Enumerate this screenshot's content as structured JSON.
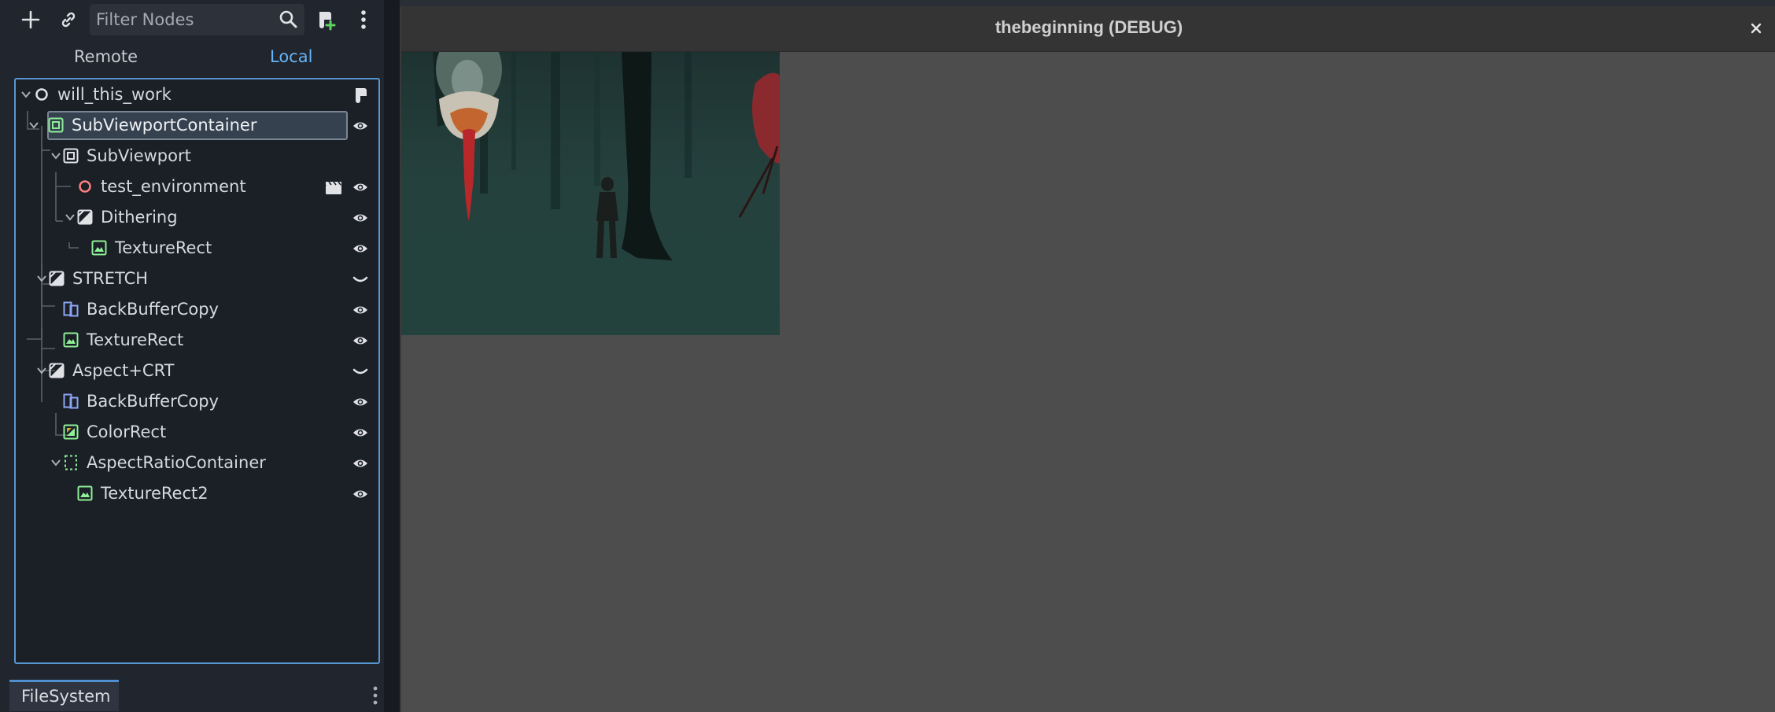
{
  "toolbar": {
    "add_node_icon": "plus-icon",
    "link_icon": "link-icon",
    "filter_placeholder": "Filter Nodes",
    "search_icon": "search-icon",
    "add_script_icon": "add-script-icon",
    "menu_icon": "kebab-menu-icon"
  },
  "mode_tabs": {
    "remote": "Remote",
    "local": "Local",
    "active": "local"
  },
  "tree": {
    "nodes": [
      {
        "label": "will_this_work",
        "type": "Node",
        "depth": 0,
        "expanded": true,
        "extra_icon": "script-icon"
      },
      {
        "label": "SubViewportContainer",
        "type": "SubViewportContainer",
        "depth": 1,
        "expanded": true,
        "selected": true,
        "visible": true
      },
      {
        "label": "SubViewport",
        "type": "SubViewport",
        "depth": 2,
        "expanded": true
      },
      {
        "label": "test_environment",
        "type": "Node3D",
        "depth": 3,
        "extra_icon": "clapperboard-icon",
        "visible": true
      },
      {
        "label": "Dithering",
        "type": "CanvasGroup",
        "depth": 3,
        "expanded": true,
        "visible": true
      },
      {
        "label": "TextureRect",
        "type": "TextureRect",
        "depth": 4,
        "visible": true
      },
      {
        "label": "STRETCH",
        "type": "CanvasGroup",
        "depth": 1,
        "expanded": true,
        "visible": false
      },
      {
        "label": "BackBufferCopy",
        "type": "BackBufferCopy",
        "depth": 2,
        "visible": true
      },
      {
        "label": "TextureRect",
        "type": "TextureRect",
        "depth": 2,
        "visible": true
      },
      {
        "label": "Aspect+CRT",
        "type": "CanvasGroup",
        "depth": 1,
        "expanded": true,
        "visible": false
      },
      {
        "label": "BackBufferCopy",
        "type": "BackBufferCopy",
        "depth": 2,
        "visible": true
      },
      {
        "label": "ColorRect",
        "type": "ColorRect",
        "depth": 2,
        "visible": true
      },
      {
        "label": "AspectRatioContainer",
        "type": "AspectRatioContainer",
        "depth": 2,
        "expanded": true,
        "visible": true
      },
      {
        "label": "TextureRect2",
        "type": "TextureRect",
        "depth": 3,
        "visible": true
      }
    ]
  },
  "bottom_dock": {
    "tab_label": "FileSystem",
    "menu_icon": "kebab-menu-icon"
  },
  "game_window": {
    "title": "thebeginning (DEBUG)",
    "close_icon": "close-icon"
  },
  "colors": {
    "accent": "#66b3f6",
    "selection_border": "#7a8594",
    "control_green": "#8eef97",
    "node2d_blue": "#8da5f3",
    "node3d_red": "#fc7f7f"
  }
}
